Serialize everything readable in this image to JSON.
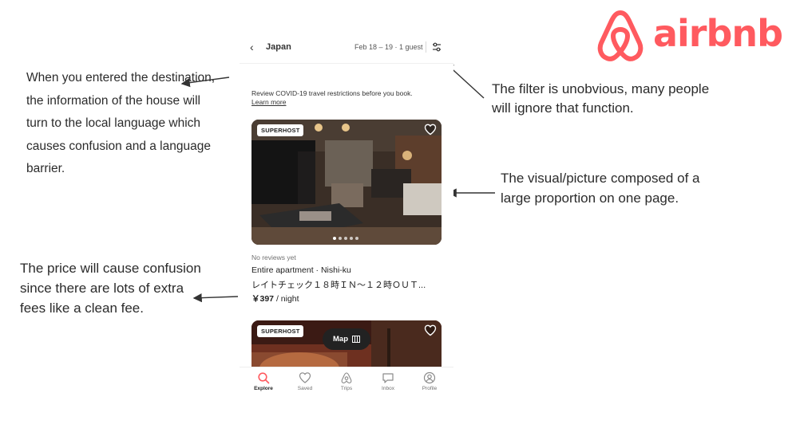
{
  "annotations": {
    "language": "When you entered the destination, the information of the house will turn to the local language which causes confusion and a language barrier.",
    "filter": "The filter is unobvious, many people will ignore that function.",
    "visual": "The visual/picture composed of a large proportion on one page.",
    "price": "The price will cause confusion since there are lots of extra fees like a clean fee."
  },
  "logo": {
    "text": "airbnb",
    "color": "#ff5a5f"
  },
  "header": {
    "back_icon": "chevron-left-icon",
    "location": "Japan",
    "dates_guests": "Feb 18 – 19 · 1 guest",
    "filter_icon": "sliders-icon"
  },
  "notice": {
    "text": "Review COVID-19 travel restrictions before you book.",
    "link": "Learn more"
  },
  "listings": [
    {
      "badge": "SUPERHOST",
      "reviews": "No reviews yet",
      "type": "Entire apartment · Nishi-ku",
      "title": "レイトチェック１８時ＩＮ～１２時ＯＵＴ...",
      "price": "￥397",
      "price_unit": " / night",
      "photo_count": 5,
      "active_photo": 0
    },
    {
      "badge": "SUPERHOST"
    }
  ],
  "map_button": {
    "label": "Map",
    "icon": "map-icon"
  },
  "tabbar": [
    {
      "label": "Explore",
      "icon": "search-icon",
      "active": true
    },
    {
      "label": "Saved",
      "icon": "heart-icon",
      "active": false
    },
    {
      "label": "Trips",
      "icon": "airbnb-icon",
      "active": false
    },
    {
      "label": "Inbox",
      "icon": "chat-icon",
      "active": false
    },
    {
      "label": "Profile",
      "icon": "user-icon",
      "active": false
    }
  ],
  "colors": {
    "accent": "#ff5a5f",
    "text": "#222222",
    "muted": "#717171"
  }
}
